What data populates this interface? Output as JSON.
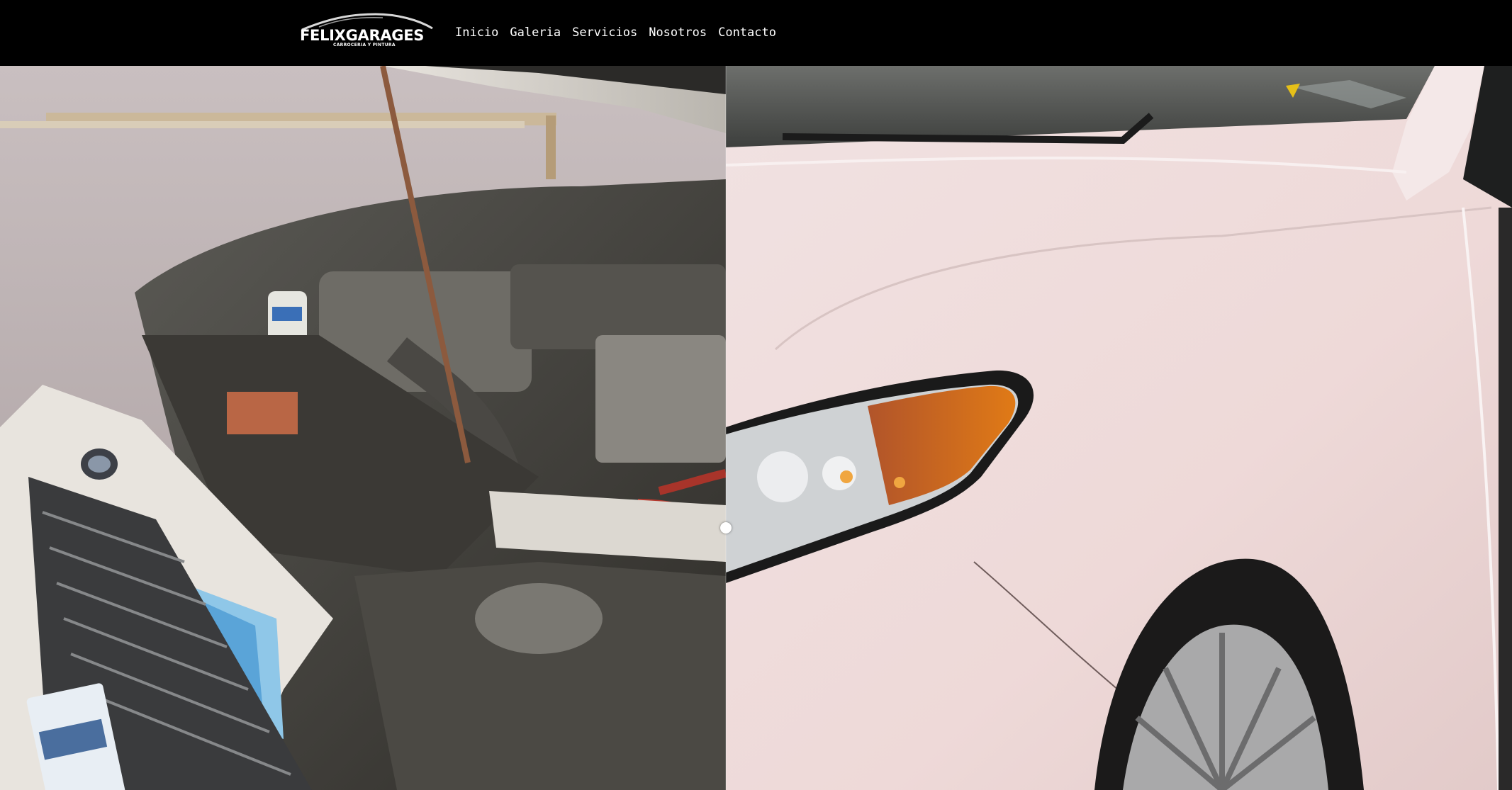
{
  "brand": {
    "name": "FELIXGARAGES",
    "tagline": "CARROCERIA Y PINTURA"
  },
  "nav": {
    "items": [
      {
        "label": "Inicio"
      },
      {
        "label": "Galeria"
      },
      {
        "label": "Servicios"
      },
      {
        "label": "Nosotros"
      },
      {
        "label": "Contacto"
      }
    ]
  },
  "hero": {
    "before_image": "damaged-car-front-photo",
    "after_image": "repaired-car-front-photo",
    "slider_position": 0.48
  },
  "colors": {
    "navbar_bg": "#000000",
    "nav_text": "#ffffff"
  }
}
